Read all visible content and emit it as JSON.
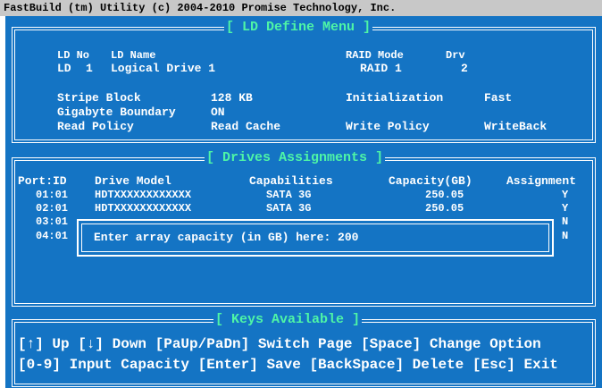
{
  "title_bar": "FastBuild (tm) Utility (c) 2004-2010 Promise Technology, Inc.",
  "ld_define": {
    "title": "[ LD Define Menu ]",
    "hdr_ldno": "LD No",
    "hdr_ldname": "LD Name",
    "hdr_raidmode": "RAID Mode",
    "hdr_drv": "Drv",
    "ld_label": "LD",
    "ld_no": "1",
    "ld_name": "Logical Drive 1",
    "raid_mode": "RAID 1",
    "drv": "2",
    "stripe_label": "Stripe Block",
    "stripe_value": "128 KB",
    "init_label": "Initialization",
    "init_value": "Fast",
    "gb_label": "Gigabyte Boundary",
    "gb_value": "ON",
    "read_label": "Read Policy",
    "read_value": "Read Cache",
    "write_label": "Write Policy",
    "write_value": "WriteBack"
  },
  "drives": {
    "title": "[ Drives Assignments ]",
    "headers": {
      "port": "Port:ID",
      "model": "Drive Model",
      "cap": "Capabilities",
      "capacity": "Capacity(GB)",
      "assign": "Assignment"
    },
    "rows": [
      {
        "port": "01:01",
        "model": "HDTXXXXXXXXXXXX",
        "cap": "SATA 3G",
        "capacity": "250.05",
        "assign": "Y"
      },
      {
        "port": "02:01",
        "model": "HDTXXXXXXXXXXXX",
        "cap": "SATA 3G",
        "capacity": "250.05",
        "assign": "Y"
      },
      {
        "port": "03:01",
        "model": "",
        "cap": "",
        "capacity": "",
        "assign": "N"
      },
      {
        "port": "04:01",
        "model": "",
        "cap": "",
        "capacity": "",
        "assign": "N"
      }
    ]
  },
  "dialog": {
    "prompt": "Enter array capacity (in GB) here: 200"
  },
  "keys": {
    "title": "[ Keys Available ]",
    "line1": "[↑] Up [↓] Down [PaUp/PaDn] Switch Page [Space] Change Option",
    "line2": "[0-9] Input Capacity [Enter] Save [BackSpace] Delete [Esc] Exit"
  }
}
